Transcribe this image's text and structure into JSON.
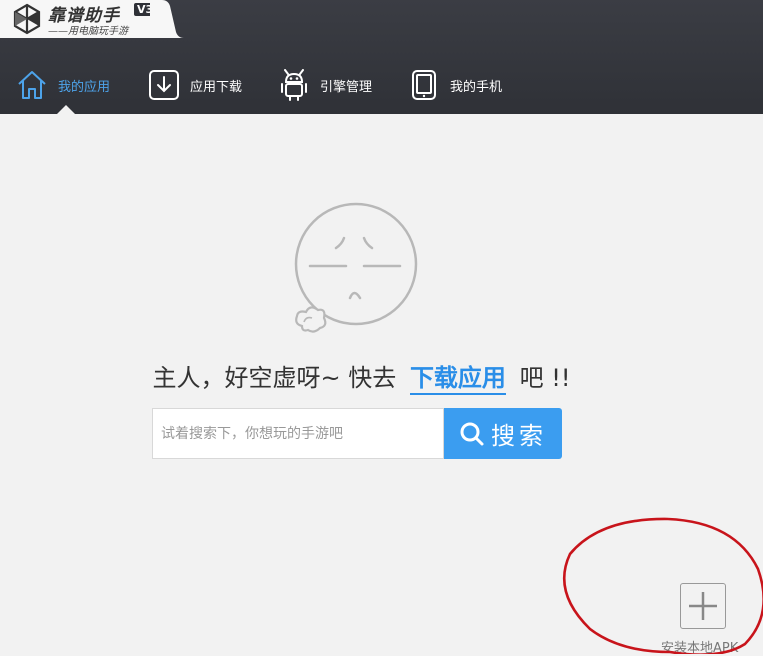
{
  "app": {
    "name": "靠谱助手",
    "version": "V3",
    "slogan": "——用电脑玩手游"
  },
  "nav": {
    "items": [
      {
        "label": "我的应用",
        "icon": "home-icon",
        "active": true
      },
      {
        "label": "应用下载",
        "icon": "download-icon",
        "active": false
      },
      {
        "label": "引擎管理",
        "icon": "android-icon",
        "active": false
      },
      {
        "label": "我的手机",
        "icon": "phone-icon",
        "active": false
      }
    ]
  },
  "main": {
    "empty_message": {
      "prefix": "主人，好空虚呀~ 快去",
      "link": "下载应用",
      "suffix": "吧 !!"
    },
    "search": {
      "placeholder": "试着搜索下，你想玩的手游吧",
      "value": "",
      "button_label": "搜索"
    },
    "install": {
      "label": "安装本地APK"
    }
  },
  "colors": {
    "accent": "#3b9df0",
    "topbar": "#35373d",
    "annotation": "#c8141b"
  }
}
